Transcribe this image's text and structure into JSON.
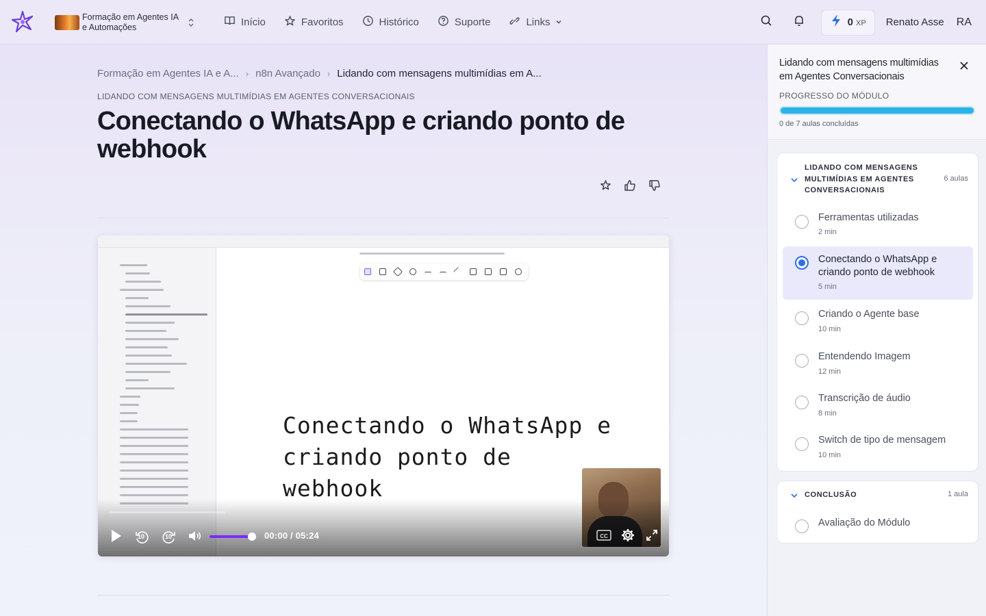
{
  "header": {
    "course_name": "Formação em Agentes IA e Automações",
    "nav": [
      {
        "label": "Início",
        "icon": "book-icon"
      },
      {
        "label": "Favoritos",
        "icon": "star-icon"
      },
      {
        "label": "Histórico",
        "icon": "clock-icon"
      },
      {
        "label": "Suporte",
        "icon": "help-circle-icon"
      },
      {
        "label": "Links",
        "icon": "link-icon"
      }
    ],
    "xp_value": "0",
    "xp_unit": "XP",
    "user_name": "Renato Asse",
    "user_initials": "RA"
  },
  "breadcrumb": [
    "Formação em Agentes IA e A...",
    "n8n Avançado",
    "Lidando com mensagens multimídias em A..."
  ],
  "lesson": {
    "eyebrow": "LIDANDO COM MENSAGENS MULTIMÍDIAS EM AGENTES CONVERSACIONAIS",
    "title": "Conectando o WhatsApp e criando ponto de webhook"
  },
  "video": {
    "caption": "Conectando o WhatsApp e criando ponto de webhook",
    "time": "00:00 / 05:24",
    "rewind_label": "10",
    "forward_label": "10",
    "progress": 0,
    "volume": 0.9
  },
  "panel": {
    "title": "Lidando com mensagens multimídias em Agentes Conversacionais",
    "progress_label": "PROGRESSO DO MÓDULO",
    "progress_text": "0 de 7 aulas concluídas",
    "progress_fraction": 1.0,
    "progress_color": "#2bb3e6",
    "sections": [
      {
        "title": "LIDANDO COM MENSAGENS MULTIMÍDIAS EM AGENTES CONVERSACIONAIS",
        "count": "6 aulas",
        "lessons": [
          {
            "title": "Ferramentas utilizadas",
            "duration": "2 min",
            "active": false
          },
          {
            "title": "Conectando o WhatsApp e criando ponto de webhook",
            "duration": "5 min",
            "active": true
          },
          {
            "title": "Criando o Agente base",
            "duration": "10 min",
            "active": false
          },
          {
            "title": "Entendendo Imagem",
            "duration": "12 min",
            "active": false
          },
          {
            "title": "Transcrição de áudio",
            "duration": "8 min",
            "active": false
          },
          {
            "title": "Switch de tipo de mensagem",
            "duration": "10 min",
            "active": false
          }
        ]
      },
      {
        "title": "CONCLUSÃO",
        "count": "1 aula",
        "lessons": [
          {
            "title": "Avaliação do Módulo",
            "duration": "",
            "active": false
          }
        ]
      }
    ]
  },
  "colors": {
    "accent": "#2f6fe6",
    "volume": "#7b2cff",
    "xp_bolt": "#2f6fe6"
  }
}
